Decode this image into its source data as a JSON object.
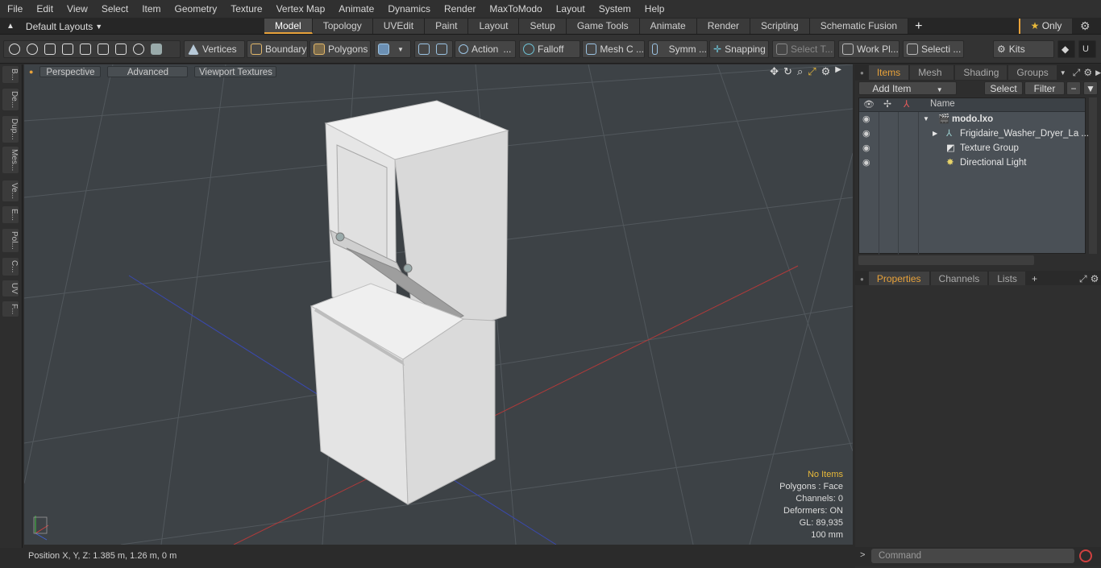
{
  "menu": [
    "File",
    "Edit",
    "View",
    "Select",
    "Item",
    "Geometry",
    "Texture",
    "Vertex Map",
    "Animate",
    "Dynamics",
    "Render",
    "MaxToModo",
    "Layout",
    "System",
    "Help"
  ],
  "layouts": {
    "label": "Default Layouts"
  },
  "mode_tabs": [
    "Model",
    "Topology",
    "UVEdit",
    "Paint",
    "Layout",
    "Setup",
    "Game Tools",
    "Animate",
    "Render",
    "Scripting",
    "Schematic Fusion"
  ],
  "active_tab": "Model",
  "only_label": "Only",
  "toolbar": {
    "vertices": "Vertices",
    "boundary": "Boundary",
    "polygons": "Polygons",
    "action": "Action",
    "falloff": "Falloff",
    "meshc": "Mesh C ...",
    "symm": "Symm ...",
    "snapping": "Snapping",
    "selectt": "Select T...",
    "workpl": "Work Pl...",
    "selecti": "Selecti ...",
    "kits": "Kits"
  },
  "left_tabs": [
    "B...",
    "De...",
    "Dup...",
    "Mes...",
    "Ve...",
    "E...",
    "Pol...",
    "C...",
    "UV",
    "F..."
  ],
  "viewport": {
    "perspective": "Perspective",
    "advanced": "Advanced",
    "viewport_textures": "Viewport Textures"
  },
  "stats": {
    "no_items": "No Items",
    "polygons": "Polygons : Face",
    "channels": "Channels: 0",
    "deformers": "Deformers: ON",
    "gl": "GL: 89,935",
    "scale": "100 mm"
  },
  "status": {
    "position": "Position X, Y, Z:   1.385 m, 1.26 m, 0 m"
  },
  "items_panel": {
    "tabs": [
      "Items",
      "Mesh ...",
      "Shading",
      "Groups"
    ],
    "add_item": "Add Item",
    "select": "Select",
    "filter": "Filter",
    "name_header": "Name",
    "rows": [
      {
        "label": "modo.lxo"
      },
      {
        "label": "Frigidaire_Washer_Dryer_La ..."
      },
      {
        "label": "Texture Group"
      },
      {
        "label": "Directional Light"
      }
    ]
  },
  "props_panel": {
    "tabs": [
      "Properties",
      "Channels",
      "Lists"
    ]
  },
  "command": {
    "placeholder": "Command"
  }
}
